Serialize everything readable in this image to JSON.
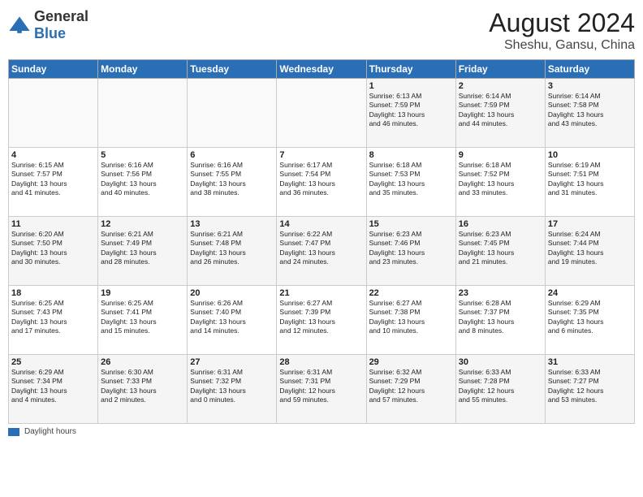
{
  "header": {
    "logo_general": "General",
    "logo_blue": "Blue",
    "month_year": "August 2024",
    "location": "Sheshu, Gansu, China"
  },
  "days_of_week": [
    "Sunday",
    "Monday",
    "Tuesday",
    "Wednesday",
    "Thursday",
    "Friday",
    "Saturday"
  ],
  "weeks": [
    [
      {
        "day": "",
        "info": ""
      },
      {
        "day": "",
        "info": ""
      },
      {
        "day": "",
        "info": ""
      },
      {
        "day": "",
        "info": ""
      },
      {
        "day": "1",
        "info": "Sunrise: 6:13 AM\nSunset: 7:59 PM\nDaylight: 13 hours\nand 46 minutes."
      },
      {
        "day": "2",
        "info": "Sunrise: 6:14 AM\nSunset: 7:59 PM\nDaylight: 13 hours\nand 44 minutes."
      },
      {
        "day": "3",
        "info": "Sunrise: 6:14 AM\nSunset: 7:58 PM\nDaylight: 13 hours\nand 43 minutes."
      }
    ],
    [
      {
        "day": "4",
        "info": "Sunrise: 6:15 AM\nSunset: 7:57 PM\nDaylight: 13 hours\nand 41 minutes."
      },
      {
        "day": "5",
        "info": "Sunrise: 6:16 AM\nSunset: 7:56 PM\nDaylight: 13 hours\nand 40 minutes."
      },
      {
        "day": "6",
        "info": "Sunrise: 6:16 AM\nSunset: 7:55 PM\nDaylight: 13 hours\nand 38 minutes."
      },
      {
        "day": "7",
        "info": "Sunrise: 6:17 AM\nSunset: 7:54 PM\nDaylight: 13 hours\nand 36 minutes."
      },
      {
        "day": "8",
        "info": "Sunrise: 6:18 AM\nSunset: 7:53 PM\nDaylight: 13 hours\nand 35 minutes."
      },
      {
        "day": "9",
        "info": "Sunrise: 6:18 AM\nSunset: 7:52 PM\nDaylight: 13 hours\nand 33 minutes."
      },
      {
        "day": "10",
        "info": "Sunrise: 6:19 AM\nSunset: 7:51 PM\nDaylight: 13 hours\nand 31 minutes."
      }
    ],
    [
      {
        "day": "11",
        "info": "Sunrise: 6:20 AM\nSunset: 7:50 PM\nDaylight: 13 hours\nand 30 minutes."
      },
      {
        "day": "12",
        "info": "Sunrise: 6:21 AM\nSunset: 7:49 PM\nDaylight: 13 hours\nand 28 minutes."
      },
      {
        "day": "13",
        "info": "Sunrise: 6:21 AM\nSunset: 7:48 PM\nDaylight: 13 hours\nand 26 minutes."
      },
      {
        "day": "14",
        "info": "Sunrise: 6:22 AM\nSunset: 7:47 PM\nDaylight: 13 hours\nand 24 minutes."
      },
      {
        "day": "15",
        "info": "Sunrise: 6:23 AM\nSunset: 7:46 PM\nDaylight: 13 hours\nand 23 minutes."
      },
      {
        "day": "16",
        "info": "Sunrise: 6:23 AM\nSunset: 7:45 PM\nDaylight: 13 hours\nand 21 minutes."
      },
      {
        "day": "17",
        "info": "Sunrise: 6:24 AM\nSunset: 7:44 PM\nDaylight: 13 hours\nand 19 minutes."
      }
    ],
    [
      {
        "day": "18",
        "info": "Sunrise: 6:25 AM\nSunset: 7:43 PM\nDaylight: 13 hours\nand 17 minutes."
      },
      {
        "day": "19",
        "info": "Sunrise: 6:25 AM\nSunset: 7:41 PM\nDaylight: 13 hours\nand 15 minutes."
      },
      {
        "day": "20",
        "info": "Sunrise: 6:26 AM\nSunset: 7:40 PM\nDaylight: 13 hours\nand 14 minutes."
      },
      {
        "day": "21",
        "info": "Sunrise: 6:27 AM\nSunset: 7:39 PM\nDaylight: 13 hours\nand 12 minutes."
      },
      {
        "day": "22",
        "info": "Sunrise: 6:27 AM\nSunset: 7:38 PM\nDaylight: 13 hours\nand 10 minutes."
      },
      {
        "day": "23",
        "info": "Sunrise: 6:28 AM\nSunset: 7:37 PM\nDaylight: 13 hours\nand 8 minutes."
      },
      {
        "day": "24",
        "info": "Sunrise: 6:29 AM\nSunset: 7:35 PM\nDaylight: 13 hours\nand 6 minutes."
      }
    ],
    [
      {
        "day": "25",
        "info": "Sunrise: 6:29 AM\nSunset: 7:34 PM\nDaylight: 13 hours\nand 4 minutes."
      },
      {
        "day": "26",
        "info": "Sunrise: 6:30 AM\nSunset: 7:33 PM\nDaylight: 13 hours\nand 2 minutes."
      },
      {
        "day": "27",
        "info": "Sunrise: 6:31 AM\nSunset: 7:32 PM\nDaylight: 13 hours\nand 0 minutes."
      },
      {
        "day": "28",
        "info": "Sunrise: 6:31 AM\nSunset: 7:31 PM\nDaylight: 12 hours\nand 59 minutes."
      },
      {
        "day": "29",
        "info": "Sunrise: 6:32 AM\nSunset: 7:29 PM\nDaylight: 12 hours\nand 57 minutes."
      },
      {
        "day": "30",
        "info": "Sunrise: 6:33 AM\nSunset: 7:28 PM\nDaylight: 12 hours\nand 55 minutes."
      },
      {
        "day": "31",
        "info": "Sunrise: 6:33 AM\nSunset: 7:27 PM\nDaylight: 12 hours\nand 53 minutes."
      }
    ]
  ],
  "legend": {
    "label": "Daylight hours"
  }
}
